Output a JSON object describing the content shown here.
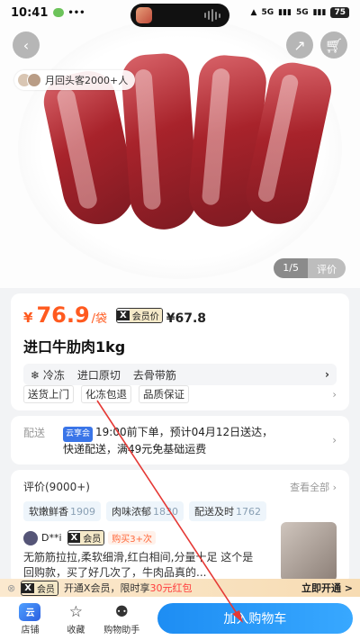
{
  "status": {
    "time": "10:41",
    "signal": "5G",
    "signal2": "5G",
    "battery": "75"
  },
  "hero": {
    "repeat_customers": "月回头客2000+人",
    "pager": "1/5",
    "pager_review": "评价"
  },
  "product": {
    "currency": "¥",
    "price": "76.9",
    "unit": "/袋",
    "vip_x": "X",
    "vip_label": "会员价",
    "vip_price": "¥67.8",
    "title": "进口牛肋肉1kg",
    "features": [
      "冷冻",
      "进口原切",
      "去骨带筋"
    ],
    "services": [
      "送货上门",
      "化冻包退",
      "品质保证"
    ]
  },
  "delivery": {
    "label": "配送",
    "tag": "云享会",
    "line1": "19:00前下单，预计04月12日送达，",
    "line2": "快递配送，满49元免基础运费"
  },
  "reviews": {
    "label": "评价(9000+)",
    "see_all": "查看全部",
    "chips": [
      {
        "name": "软嫩鲜香",
        "count": "1909"
      },
      {
        "name": "肉味浓郁",
        "count": "1830"
      },
      {
        "name": "配送及时",
        "count": "1762"
      }
    ],
    "reviewer": "D**i",
    "reviewer_badge": "会员",
    "buy_tag": "购买3+次",
    "text": "无筋筋拉拉,柔软细滑,红白相间,分量十足 这个是回购款，买了好几次了，牛肉品真的..."
  },
  "vip_banner": {
    "x": "X",
    "badge": "会员",
    "text": "开通X会员，限时享",
    "highlight": "30元红包",
    "action": "立即开通 >"
  },
  "bottom_nav": {
    "store_icon_text": "云",
    "store": "店铺",
    "favorite": "收藏",
    "assistant": "购物助手",
    "add_to_cart": "加入购物车"
  },
  "colors": {
    "accent": "#1d8df3",
    "price": "#ff5a1f",
    "annotation": "#e53935"
  }
}
